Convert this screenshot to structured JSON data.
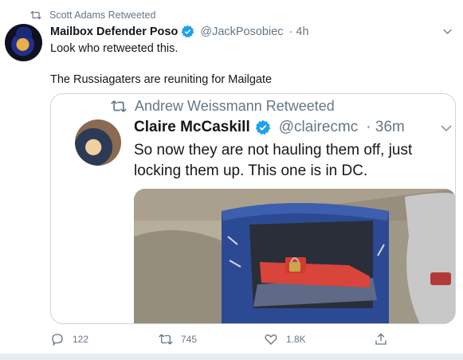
{
  "retweet_banner": {
    "label": "Scott Adams Retweeted",
    "icon": "retweet-icon"
  },
  "tweet": {
    "author_name": "Mailbox Defender Poso",
    "handle": "@JackPosobiec",
    "time": "· 4h",
    "verified": true,
    "text_line1": "Look who retweeted this.",
    "text_line2": "The Russiagaters are reuniting for Mailgate",
    "avatar": "profile-avatar"
  },
  "quoted": {
    "retweet_label": "Andrew Weissmann Retweeted",
    "author_name": "Claire McCaskill",
    "handle": "@clairecmc",
    "time": "· 36m",
    "verified": true,
    "text": "So now they are not hauling them off, just locking them up. This one is in DC.",
    "photo": "mailbox-photo"
  },
  "actions": {
    "replies": "122",
    "retweets": "745",
    "likes": "1.8K"
  },
  "colors": {
    "accent": "#1da1f2",
    "muted": "#657786",
    "border": "#ccd6dd",
    "text": "#14171a"
  }
}
